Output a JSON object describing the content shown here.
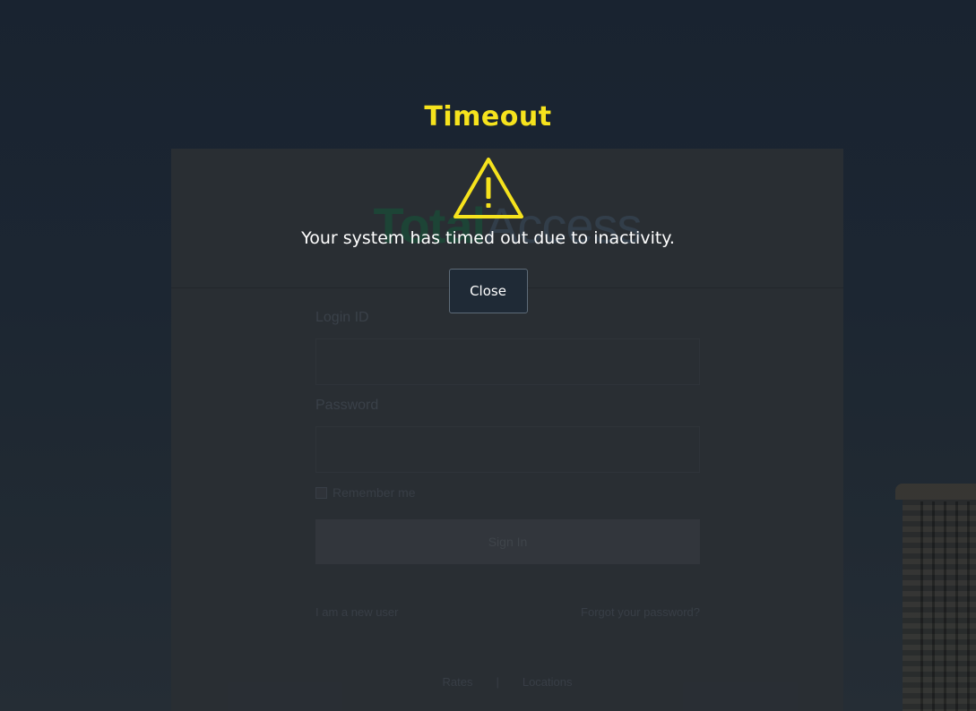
{
  "login": {
    "logo_part1": "Total",
    "logo_part2": "Access",
    "login_id_label": "Login ID",
    "password_label": "Password",
    "remember_label": "Remember me",
    "signin_label": "Sign In",
    "new_user_link": "I am a new user",
    "forgot_link": "Forgot your password?",
    "footer_links": [
      "Rates",
      "Locations"
    ],
    "footer_separator": "|"
  },
  "modal": {
    "title": "Timeout",
    "message": "Your system has timed out due to inactivity.",
    "close_label": "Close",
    "icon": "warning-triangle-icon",
    "accent_color": "#f6e31d"
  }
}
